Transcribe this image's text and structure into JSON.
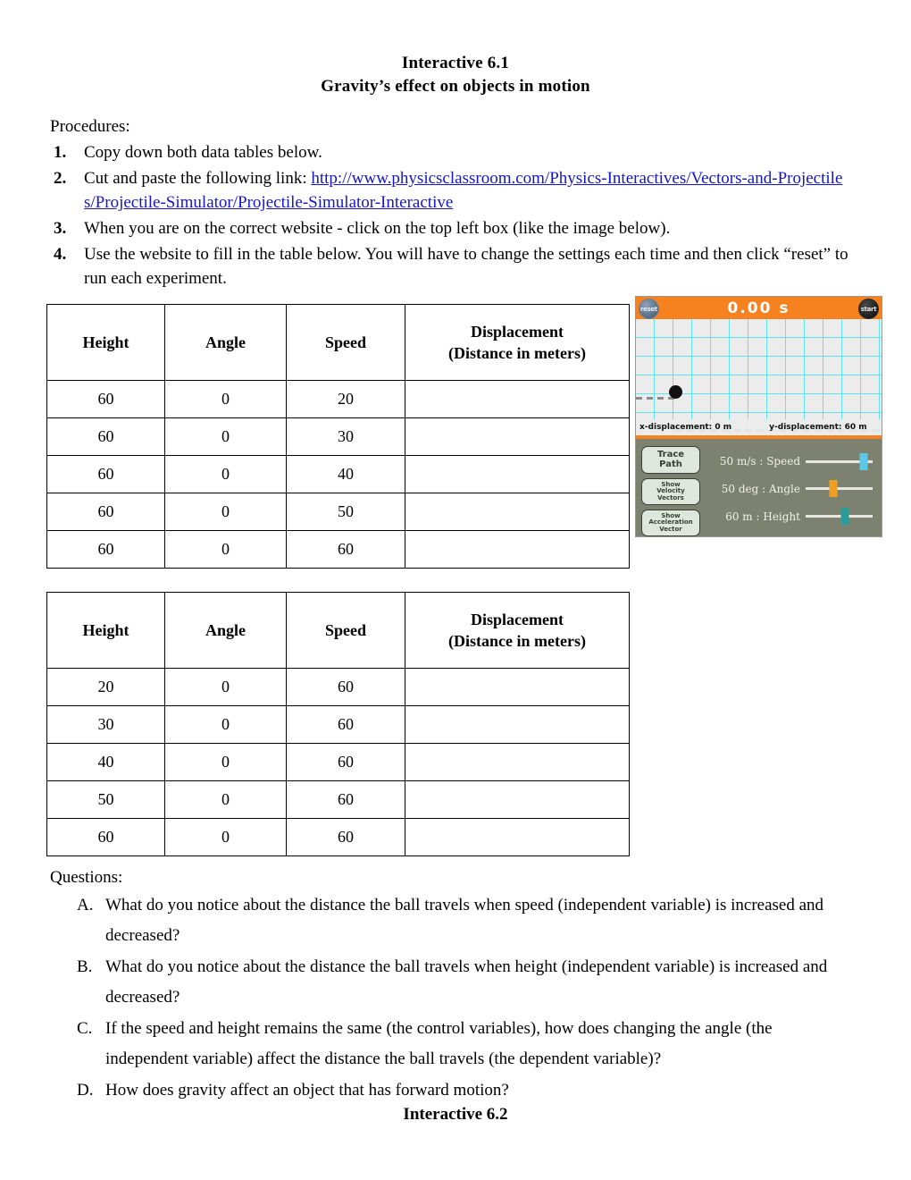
{
  "document": {
    "title_line_1": "Interactive 6.1",
    "title_line_2": "Gravity’s effect on objects in motion",
    "footer_title": "Interactive 6.2"
  },
  "procedures": {
    "heading": "Procedures:",
    "items": [
      {
        "number": "1.",
        "text": "Copy down both data tables below."
      },
      {
        "number": "2.",
        "text_before_link": "Cut and paste the following link: ",
        "link_text": "http://www.physicsclassroom.com/Physics-Interactives/Vectors-and-Projectiles/Projectile-Simulator/Projectile-Simulator-Interactive",
        "link_color": "#1616c8"
      },
      {
        "number": "3.",
        "text": "When you are on the correct website - click on the top left box (like the image below)."
      },
      {
        "number": "4.",
        "text": "Use the website to fill in the table below. You will have to change the settings each time and then click “reset” to run each experiment."
      }
    ]
  },
  "table_speed": {
    "headers": [
      "Height",
      "Angle",
      "Speed",
      "Displacement\n(Distance in meters)"
    ],
    "header_displacement_line1": "Displacement",
    "header_displacement_line2": "(Distance in meters)",
    "rows": [
      {
        "height": "60",
        "angle": "0",
        "speed": "20",
        "displacement": ""
      },
      {
        "height": "60",
        "angle": "0",
        "speed": "30",
        "displacement": ""
      },
      {
        "height": "60",
        "angle": "0",
        "speed": "40",
        "displacement": ""
      },
      {
        "height": "60",
        "angle": "0",
        "speed": "50",
        "displacement": ""
      },
      {
        "height": "60",
        "angle": "0",
        "speed": "60",
        "displacement": ""
      }
    ]
  },
  "table_height": {
    "headers": [
      "Height",
      "Angle",
      "Speed",
      "Displacement\n(Distance in meters)"
    ],
    "header_displacement_line1": "Displacement",
    "header_displacement_line2": "(Distance in meters)",
    "rows": [
      {
        "height": "20",
        "angle": "0",
        "speed": "60",
        "displacement": ""
      },
      {
        "height": "30",
        "angle": "0",
        "speed": "60",
        "displacement": ""
      },
      {
        "height": "40",
        "angle": "0",
        "speed": "60",
        "displacement": ""
      },
      {
        "height": "50",
        "angle": "0",
        "speed": "60",
        "displacement": ""
      },
      {
        "height": "60",
        "angle": "0",
        "speed": "60",
        "displacement": ""
      }
    ]
  },
  "simulator": {
    "timer": "0.00  s",
    "reset_label": "reset",
    "start_label": "start",
    "x_displacement": "x-displacement: 0 m",
    "y_displacement": "y-displacement: 60 m",
    "header_color": "#f5821f",
    "panel_color": "#7d8270",
    "grid_color": "#5fe3ef",
    "toggles": [
      {
        "line1": "Trace",
        "line2": "Path",
        "line3": ""
      },
      {
        "line1": "Show",
        "line2": "Velocity",
        "line3": "Vectors"
      },
      {
        "line1": "Show",
        "line2": "Acceleration",
        "line3": "Vector"
      }
    ],
    "sliders": [
      {
        "label": "50 m/s  : Speed",
        "value": "50 m/s",
        "name": "Speed",
        "handle_color": "#5bc8e8",
        "position_pct": 86
      },
      {
        "label": "50 deg  : Angle",
        "value": "50 deg",
        "name": "Angle",
        "handle_color": "#efa022",
        "position_pct": 41
      },
      {
        "label": "60 m  : Height",
        "value": "60 m",
        "name": "Height",
        "handle_color": "#2a9d9a",
        "position_pct": 58
      }
    ]
  },
  "questions": {
    "heading": "Questions:",
    "items": [
      {
        "letter": "A.",
        "text": "What do you notice about the distance the ball travels when speed (independent variable) is increased and decreased?"
      },
      {
        "letter": "B.",
        "text": "What do you notice about the distance the ball travels when height (independent variable) is increased and decreased?"
      },
      {
        "letter": "C.",
        "text": "If the speed and height remains the same (the control variables), how does changing the angle (the independent variable) affect the distance the ball travels (the dependent variable)?"
      },
      {
        "letter": "D.",
        "text": "How does gravity affect an object that has forward motion?"
      }
    ]
  }
}
